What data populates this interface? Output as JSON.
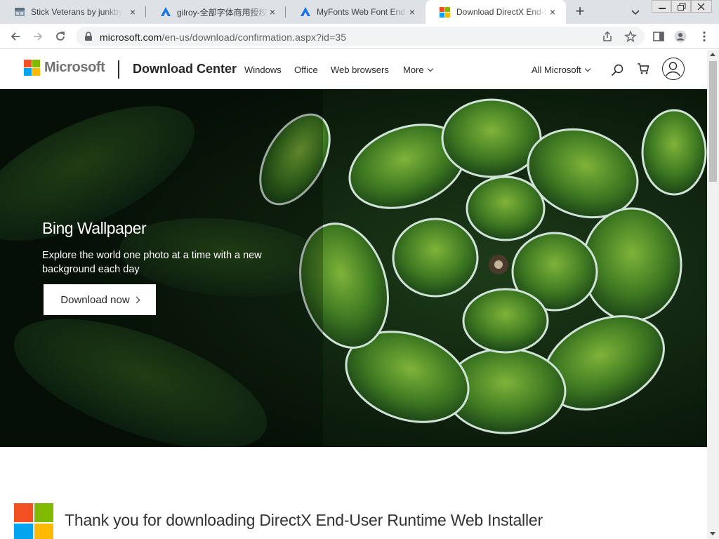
{
  "browser": {
    "tabs": [
      {
        "title": "Stick Veterans by junkbyt",
        "favicon": "stick-veterans-favicon",
        "active": false
      },
      {
        "title": "gilroy-全部字体商用授权",
        "favicon": "triangle-logo-icon",
        "active": false
      },
      {
        "title": "MyFonts Web Font End U",
        "favicon": "triangle-logo-icon",
        "active": false
      },
      {
        "title": "Download DirectX End-U",
        "favicon": "microsoft-logo-icon",
        "active": true
      }
    ],
    "close_glyph": "×",
    "new_tab_glyph": "+",
    "url_host": "microsoft.com",
    "url_path": "/en-us/download/confirmation.aspx?id=35"
  },
  "site": {
    "brand": "Microsoft",
    "title": "Download Center",
    "nav": [
      "Windows",
      "Office",
      "Web browsers",
      "More"
    ],
    "all_microsoft": "All Microsoft",
    "logo_colors": [
      "#f25022",
      "#7fba00",
      "#00a4ef",
      "#ffb900"
    ]
  },
  "hero": {
    "title": "Bing Wallpaper",
    "text": "Explore the world one photo at a time with a new background each day",
    "button": "Download now"
  },
  "main": {
    "thanks": "Thank you for downloading DirectX End-User Runtime Web Installer"
  }
}
